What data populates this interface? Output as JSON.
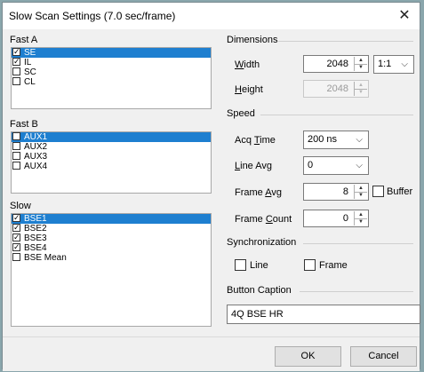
{
  "window": {
    "title": "Slow Scan Settings (7.0 sec/frame)",
    "close_glyph": "✕"
  },
  "fast_a": {
    "label": "Fast A",
    "items": [
      {
        "label": "SE",
        "checked": true,
        "selected": true
      },
      {
        "label": "IL",
        "checked": true,
        "selected": false
      },
      {
        "label": "SC",
        "checked": false,
        "selected": false
      },
      {
        "label": "CL",
        "checked": false,
        "selected": false
      }
    ]
  },
  "fast_b": {
    "label": "Fast B",
    "items": [
      {
        "label": "AUX1",
        "checked": false,
        "selected": true
      },
      {
        "label": "AUX2",
        "checked": false,
        "selected": false
      },
      {
        "label": "AUX3",
        "checked": false,
        "selected": false
      },
      {
        "label": "AUX4",
        "checked": false,
        "selected": false
      }
    ]
  },
  "slow": {
    "label": "Slow",
    "items": [
      {
        "label": "BSE1",
        "checked": true,
        "selected": true
      },
      {
        "label": "BSE2",
        "checked": true,
        "selected": false
      },
      {
        "label": "BSE3",
        "checked": true,
        "selected": false
      },
      {
        "label": "BSE4",
        "checked": true,
        "selected": false
      },
      {
        "label": "BSE Mean",
        "checked": false,
        "selected": false
      }
    ]
  },
  "dimensions": {
    "label": "Dimensions",
    "width_label_u": "W",
    "width_label_rest": "idth",
    "width_value": "2048",
    "ratio_value": "1:1",
    "height_label_u": "H",
    "height_label_rest": "eight",
    "height_value": "2048"
  },
  "speed": {
    "label": "Speed",
    "acq_time_label_a": "Acq ",
    "acq_time_label_u": "T",
    "acq_time_label_b": "ime",
    "acq_time_value": "200 ns",
    "line_avg_label_u": "L",
    "line_avg_label_rest": "ine Avg",
    "line_avg_value": "0",
    "frame_avg_label_a": "Frame ",
    "frame_avg_label_u": "A",
    "frame_avg_label_b": "vg",
    "frame_avg_value": "8",
    "buffer_label": "Buffer",
    "frame_count_label_a": "Frame ",
    "frame_count_label_u": "C",
    "frame_count_label_b": "ount",
    "frame_count_value": "0"
  },
  "synchronization": {
    "label": "Synchronization",
    "line_label": "Line",
    "frame_label": "Frame"
  },
  "button_caption": {
    "label": "Button Caption",
    "value": "4Q BSE HR"
  },
  "footer": {
    "ok_label": "OK",
    "cancel_label": "Cancel"
  },
  "icons": {
    "check": "✓",
    "up": "▲",
    "down": "▼",
    "chevron": "⌵"
  },
  "colors": {
    "selection": "#1e7fd0",
    "dialog_bg": "#f0f0f0"
  }
}
